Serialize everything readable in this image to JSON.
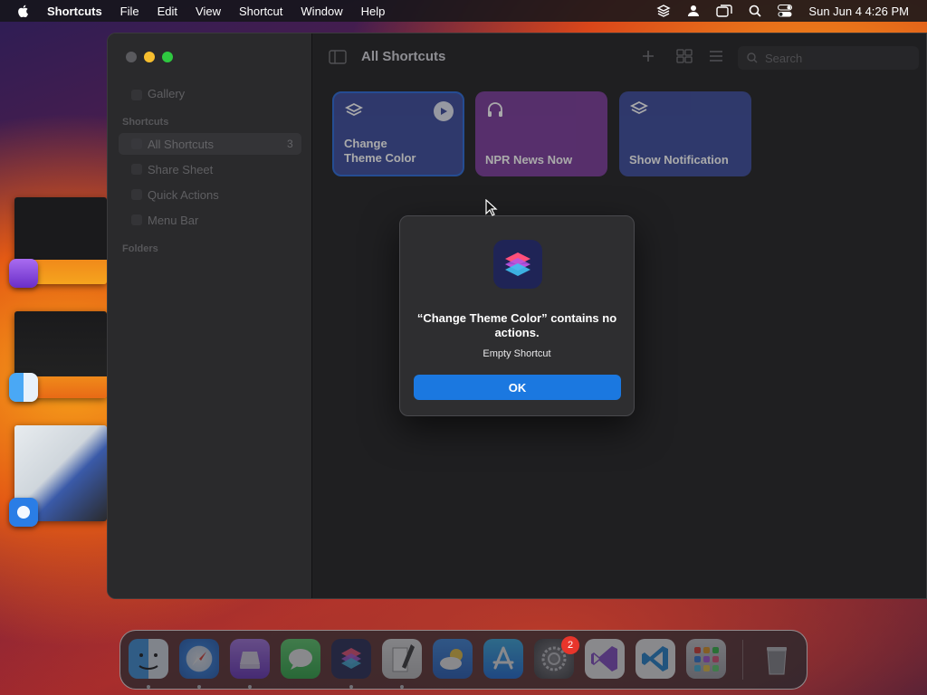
{
  "menubar": {
    "app_name": "Shortcuts",
    "menus": [
      "File",
      "Edit",
      "View",
      "Shortcut",
      "Window",
      "Help"
    ],
    "clock": "Sun Jun 4  4:26 PM",
    "status_icons": [
      "layers-icon",
      "user-icon",
      "screen-mirroring-icon",
      "search-icon",
      "control-center-icon"
    ]
  },
  "sidebar": {
    "gallery": "Gallery",
    "section_shortcuts": "Shortcuts",
    "items": [
      {
        "label": "All Shortcuts",
        "count": "3"
      },
      {
        "label": "Share Sheet"
      },
      {
        "label": "Quick Actions"
      },
      {
        "label": "Menu Bar"
      }
    ],
    "section_folders": "Folders"
  },
  "toolbar": {
    "title": "All Shortcuts",
    "search_placeholder": "Search"
  },
  "shortcuts": [
    {
      "name_line1": "Change",
      "name_line2": "Theme Color",
      "color": "#3a4a9a",
      "icon": "layers-icon"
    },
    {
      "name_line1": "",
      "name_line2": "NPR News Now",
      "color": "#7a3a9a",
      "icon": "headphones-icon"
    },
    {
      "name_line1": "",
      "name_line2": "Show Notification",
      "color": "#3a4a9a",
      "icon": "layers-icon"
    }
  ],
  "dialog": {
    "message": "“Change Theme Color” contains no actions.",
    "subtitle": "Empty Shortcut",
    "ok_label": "OK"
  },
  "dock": {
    "apps": [
      "finder",
      "safari",
      "disk-utility",
      "messages",
      "shortcuts",
      "script-editor",
      "weather",
      "app-store",
      "system-settings",
      "visual-studio",
      "vscode",
      "launchpad",
      "trash"
    ],
    "system_settings_badge": "2"
  },
  "colors": {
    "accent": "#1b78e0",
    "window_bg": "#1f1f21",
    "sidebar_bg": "#2a2a2c"
  }
}
